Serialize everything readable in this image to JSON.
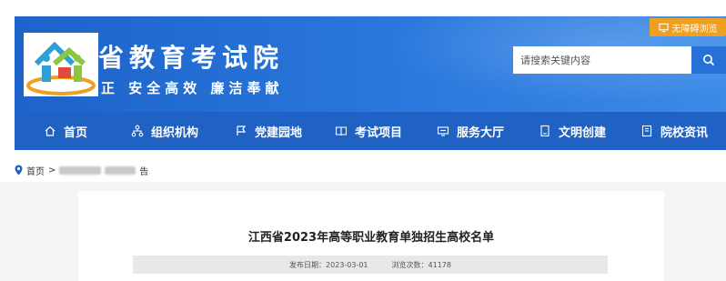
{
  "header": {
    "site_title": "省教育考试院",
    "slogan": "正 安全高效 廉洁奉献",
    "a11y_label": "无障碍浏览",
    "search_placeholder": "请搜索关键内容"
  },
  "nav": {
    "items": [
      {
        "label": "首页",
        "icon": "home-icon"
      },
      {
        "label": "组织机构",
        "icon": "org-chart-icon"
      },
      {
        "label": "党建园地",
        "icon": "flag-icon"
      },
      {
        "label": "考试项目",
        "icon": "book-icon"
      },
      {
        "label": "服务大厅",
        "icon": "service-icon"
      },
      {
        "label": "文明创建",
        "icon": "document-icon"
      },
      {
        "label": "院校资讯",
        "icon": "news-icon"
      }
    ]
  },
  "breadcrumb": {
    "home": "首页",
    "separator": ">",
    "current_prefix": "告"
  },
  "article": {
    "title": "江西省2023年高等职业教育单独招生高校名单",
    "publish_label": "发布日期：",
    "publish_date": "2023-03-01",
    "views_label": "浏览次数：",
    "views": "41178"
  },
  "colors": {
    "nav_bg": "#1f62c4",
    "header_bg": "#2a78dd",
    "a11y_bg": "#f0a020"
  }
}
